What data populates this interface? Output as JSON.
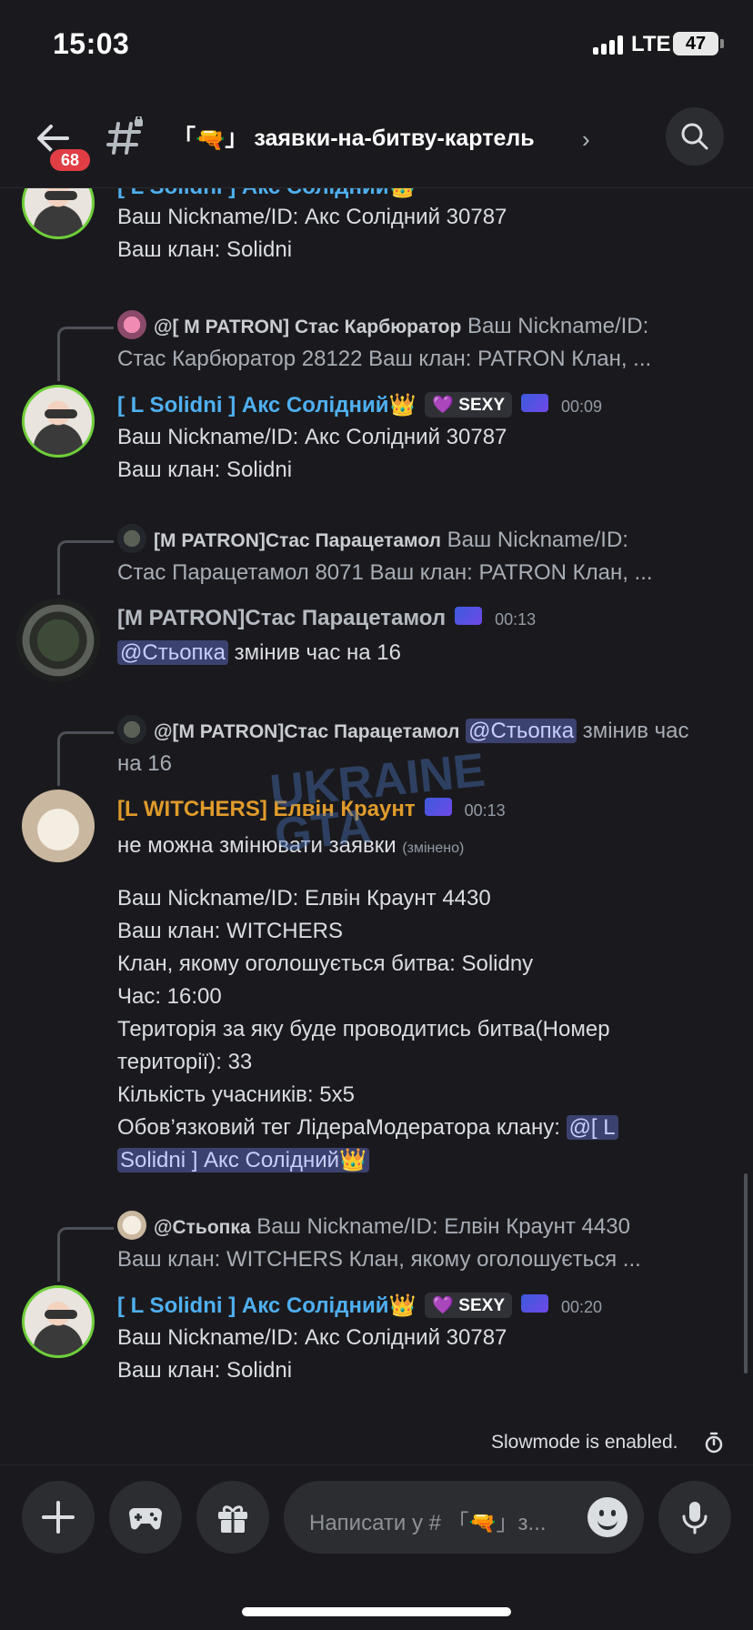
{
  "status": {
    "time": "15:03",
    "network": "LTE",
    "battery": "47"
  },
  "header": {
    "badge": "68",
    "channel_prefix": "「",
    "channel_suffix": "」",
    "channel_name": "заявки-на-битву-картель",
    "gun": "🔫"
  },
  "messages": [
    {
      "name": "[ L Solidni ] Акс Солідний👑",
      "lines": [
        "Ваш Nickname/ID: Акс Солідний 30787",
        "Ваш клан:  Solidni"
      ]
    },
    {
      "reply_name": "@[ M PATRON] Стас Карбюратор",
      "reply_text_1": " Ваш Nickname/ID:",
      "reply_text_2": "Стас Карбюратор 28122 Ваш клан: PATRON Клан, ...",
      "name": "[ L Solidni ] Акс Солідний👑",
      "tag": "💜 SEXY",
      "time": "00:09",
      "lines": [
        "Ваш Nickname/ID: Акс Солідний 30787",
        "Ваш клан:  Solidni"
      ]
    },
    {
      "reply_name": "[M PATRON]Стас Парацетамол",
      "reply_text_1": " Ваш Nickname/ID:",
      "reply_text_2": "Стас Парацетамол 8071 Ваш клан: PATRON Клан, ...",
      "name": "[M PATRON]Стас Парацетамол",
      "time": "00:13",
      "mention": "@Стьопка",
      "text": " змінив час на 16"
    },
    {
      "reply_name": "@[M PATRON]Стас Парацетамол",
      "reply_mention": "@Стьопка",
      "reply_text_1": " змінив час",
      "reply_text_2": "на 16",
      "name": "[L WITCHERS] Елвін Краунт",
      "time": "00:13",
      "first_line": "не можна змінювати заявки ",
      "edited": "(змінено)",
      "lines": [
        "Ваш Nickname/ID: Елвін Краунт 4430",
        "Ваш клан: WITCHERS",
        "Клан, якому оголошується битва:  Solidny",
        "Час: 16:00",
        "Територія за яку буде проводитись битва(Номер",
        "території): 33",
        "Кількість учасників:  5x5",
        "Обов’язковий тег ЛідераМодератора клану: "
      ],
      "tag_mention_1": "@[ L",
      "tag_mention_2": "Solidni ] Акс Солідний👑"
    },
    {
      "reply_name": "@Стьопка",
      "reply_text_1": " Ваш Nickname/ID: Елвін Краунт 4430",
      "reply_text_2": "Ваш клан: WITCHERS Клан, якому оголошується ...",
      "name": "[ L Solidni ] Акс Солідний👑",
      "tag": "💜 SEXY",
      "time": "00:20",
      "lines": [
        "Ваш Nickname/ID: Акс Солідний 30787",
        "Ваш клан:  Solidni"
      ]
    }
  ],
  "watermark": "UKRAINE GTA",
  "footer": {
    "slowmode": "Slowmode is enabled.",
    "placeholder": "Написати у # 「🔫」з..."
  }
}
